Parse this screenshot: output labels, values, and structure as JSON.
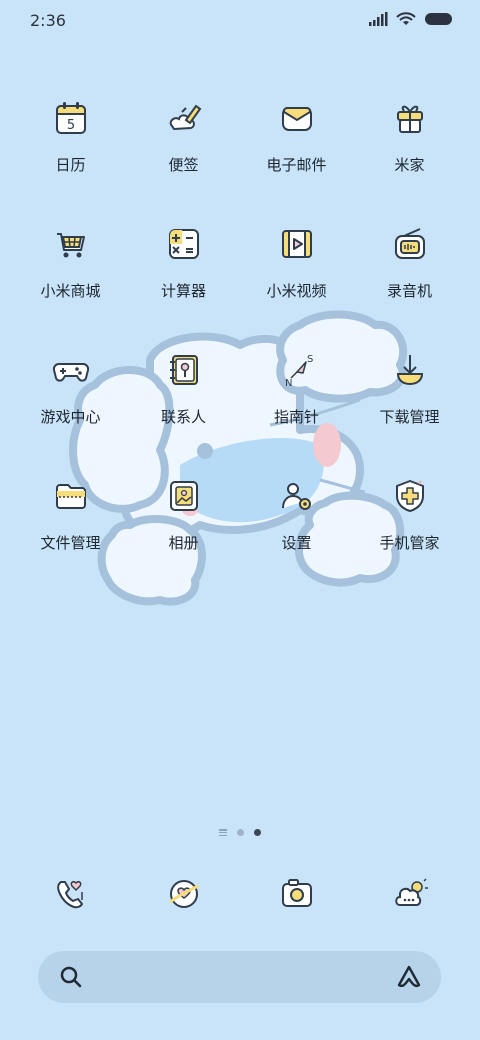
{
  "status": {
    "time": "2:36"
  },
  "apps": [
    {
      "label": "日历",
      "icon": "calendar-icon",
      "calendar_day": "5"
    },
    {
      "label": "便签",
      "icon": "notes-icon"
    },
    {
      "label": "电子邮件",
      "icon": "email-icon"
    },
    {
      "label": "米家",
      "icon": "mi-home-icon"
    },
    {
      "label": "小米商城",
      "icon": "mi-store-icon"
    },
    {
      "label": "计算器",
      "icon": "calculator-icon"
    },
    {
      "label": "小米视频",
      "icon": "mi-video-icon"
    },
    {
      "label": "录音机",
      "icon": "recorder-icon"
    },
    {
      "label": "游戏中心",
      "icon": "game-center-icon"
    },
    {
      "label": "联系人",
      "icon": "contacts-icon"
    },
    {
      "label": "指南针",
      "icon": "compass-icon",
      "compass_n": "N",
      "compass_s": "S"
    },
    {
      "label": "下载管理",
      "icon": "download-icon"
    },
    {
      "label": "文件管理",
      "icon": "file-manager-icon"
    },
    {
      "label": "相册",
      "icon": "gallery-icon"
    },
    {
      "label": "设置",
      "icon": "settings-icon"
    },
    {
      "label": "手机管家",
      "icon": "security-icon"
    }
  ],
  "pager": {
    "pages": 2,
    "current": 2
  },
  "dock": [
    {
      "icon": "phone-icon"
    },
    {
      "icon": "messaging-icon"
    },
    {
      "icon": "camera-icon"
    },
    {
      "icon": "weather-chat-icon"
    }
  ],
  "colors": {
    "background": "#c9e4f8",
    "search_bar": "#b7d3e9",
    "accent_yellow": "#f7dc7a",
    "outline": "#2f3d4c"
  }
}
